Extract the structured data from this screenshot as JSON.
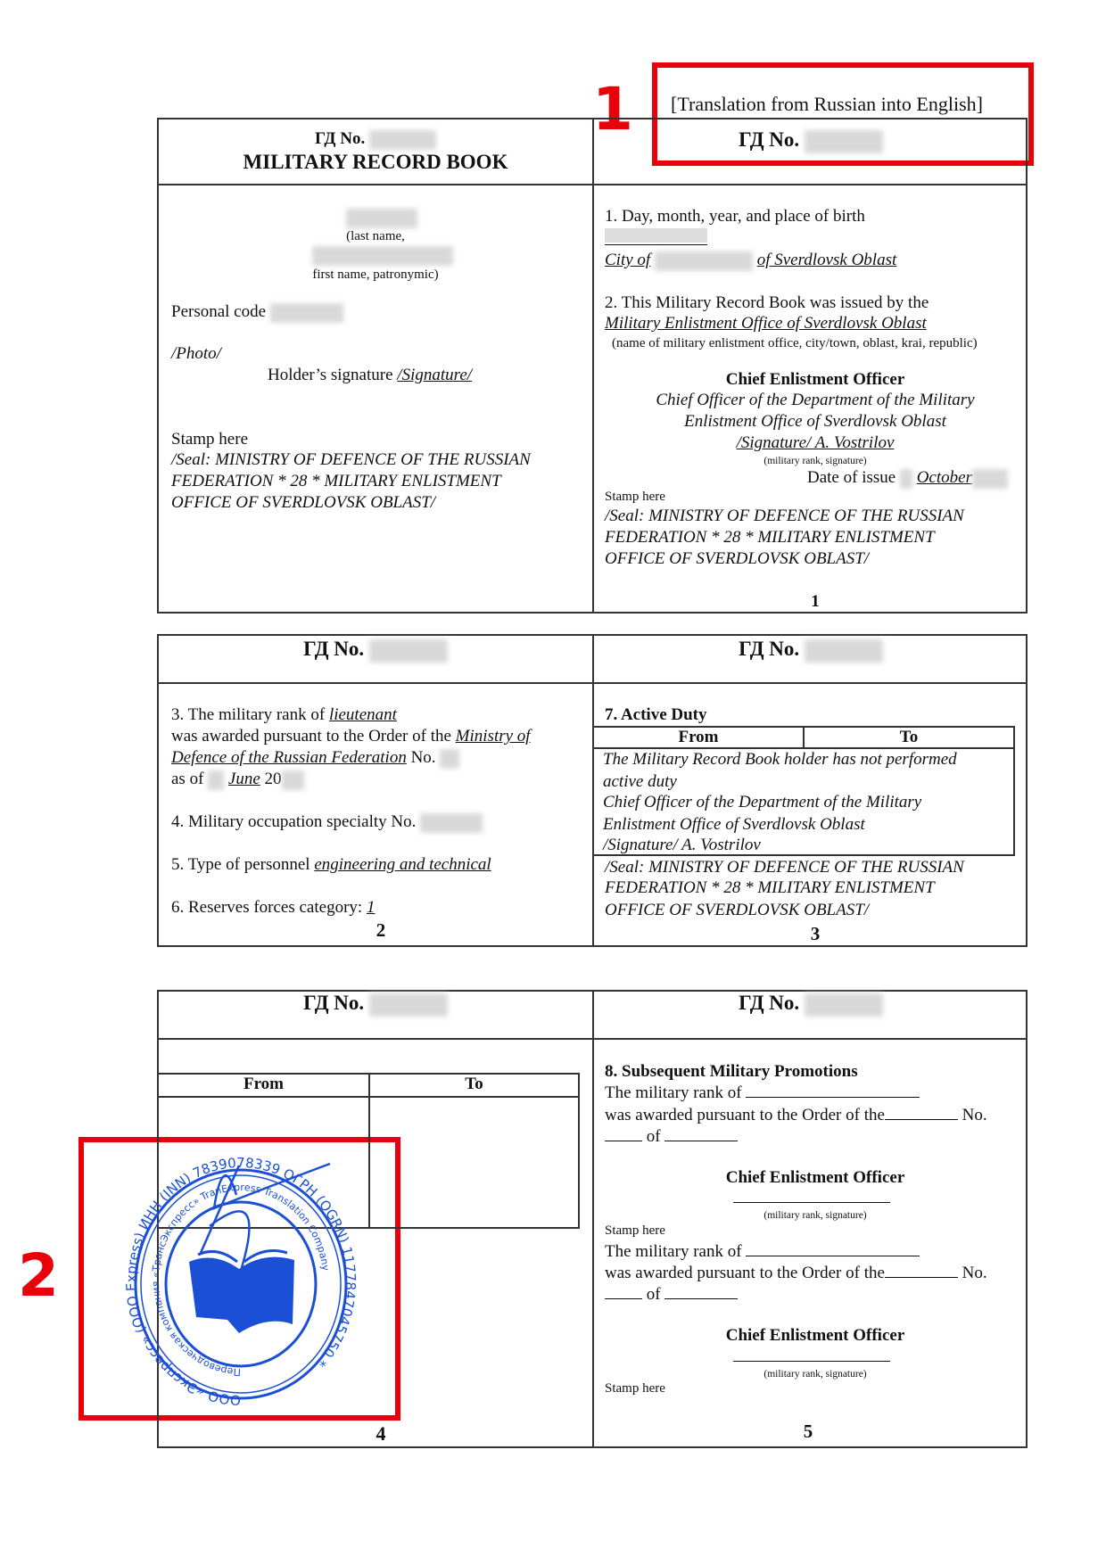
{
  "annotations": {
    "marker_1": "1",
    "marker_2": "2",
    "color": "#e8000b"
  },
  "translation_note": "[Translation from Russian into English]",
  "doc_no_label": "ГД No.",
  "page1": {
    "title": "MILITARY RECORD BOOK",
    "last_name_caption": "(last name,",
    "first_name_caption": "first name, patronymic)",
    "personal_code_label": "Personal code",
    "photo": "/Photo/",
    "holder_signature_label": "Holder’s signature",
    "holder_signature_value": "/Signature/",
    "stamp_here": "Stamp here",
    "seal_lines": [
      "/Seal: MINISTRY OF DEFENCE OF THE RUSSIAN",
      "FEDERATION * 28 * MILITARY ENLISTMENT",
      "OFFICE OF SVERDLOVSK OBLAST/"
    ],
    "item1_label": "1. Day, month, year, and place of birth",
    "item1_city_prefix": "City of",
    "item1_city_suffix": "of Sverdlovsk Oblast",
    "item2_label": "2. This Military Record Book was issued by the",
    "item2_value": "Military Enlistment Office of Sverdlovsk Oblast",
    "item2_caption": "(name of military enlistment office, city/town, oblast, krai, republic)",
    "chief_title": "Chief Enlistment Officer",
    "chief_lines": [
      "Chief Officer of the Department of the Military",
      "Enlistment Office of Sverdlovsk Oblast",
      "/Signature/ A. Vostrilov"
    ],
    "rank_signature_caption": "(military rank, signature)",
    "date_of_issue_label": "Date of issue",
    "date_of_issue_month": "October",
    "page_number": "1"
  },
  "page2": {
    "item3_line1_prefix": "3. The military rank of",
    "item3_rank": "lieutenant",
    "item3_line2_prefix": "was awarded pursuant to the Order of the",
    "item3_order_part1": "Ministry of",
    "item3_order_part2": "Defence of the Russian Federation",
    "item3_no": "No.",
    "item3_as_of": "as of",
    "item3_month": "June",
    "item3_year_prefix": "20",
    "item4_label": "4. Military occupation specialty No.",
    "item5_label": "5. Type of personnel",
    "item5_value": "engineering and technical",
    "item6_label": "6. Reserves forces category:",
    "item6_value": "1",
    "page_number": "2"
  },
  "page3": {
    "item7_title": "7. Active Duty",
    "col_from": "From",
    "col_to": "To",
    "duty_lines": [
      "The Military Record Book holder has not performed",
      "active duty",
      "Chief Officer of the Department of the Military",
      "Enlistment Office of Sverdlovsk Oblast",
      "/Signature/ A. Vostrilov"
    ],
    "seal_lines": [
      "/Seal: MINISTRY OF DEFENCE OF THE RUSSIAN",
      "FEDERATION * 28 * MILITARY ENLISTMENT",
      "OFFICE OF SVERDLOVSK OBLAST/"
    ],
    "page_number": "3"
  },
  "page4": {
    "col_from": "From",
    "col_to": "To",
    "page_number": "4",
    "stamp": {
      "outer_text": "ООО «Экспресс» (OOO Express) ИНН (INN) 7839078339 ОГРН (OGRN) 1177847045750 *",
      "inner_text": "Переводческая компания «ТрансЭкспресс» TranExpress Translation Company",
      "color": "#1a4fd6"
    }
  },
  "page5": {
    "item8_title": "8. Subsequent Military Promotions",
    "rank_of": "The military rank of",
    "awarded": "was awarded pursuant to the Order of the",
    "no": "No.",
    "of": "of",
    "chief_title": "Chief Enlistment Officer",
    "rank_signature_caption": "(military rank, signature)",
    "stamp_here": "Stamp here",
    "page_number": "5"
  }
}
